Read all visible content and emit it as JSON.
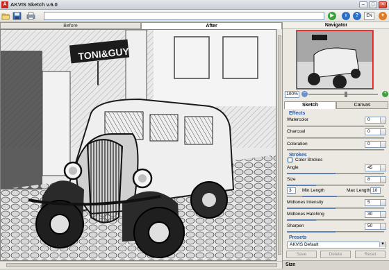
{
  "window": {
    "title": "AKVIS Sketch v.6.0",
    "app_icon": "A"
  },
  "toolbar": {
    "lang": "EN",
    "address": ""
  },
  "view_tabs": {
    "before": "Before",
    "after": "After"
  },
  "navigator": {
    "title": "Navigator",
    "zoom": "100%"
  },
  "panel_tabs": {
    "sketch": "Sketch",
    "canvas": "Canvas"
  },
  "effects": {
    "title": "Effects",
    "items": [
      {
        "label": "Watercolor",
        "value": "0",
        "level": 0
      },
      {
        "label": "Charcoal",
        "value": "0",
        "level": 0
      },
      {
        "label": "Coloration",
        "value": "0",
        "level": 0
      }
    ]
  },
  "strokes": {
    "title": "Strokes",
    "color_strokes": "Color Strokes",
    "angle": {
      "label": "Angle",
      "value": "45",
      "level": 0.5
    },
    "size": {
      "label": "Size",
      "value": "8",
      "level": 0.3
    },
    "min_length": {
      "label": "Min Length",
      "value": "3"
    },
    "max_length": {
      "label": "Max Length",
      "value": "10"
    },
    "midtones_intensity": {
      "label": "Midtones Intensity",
      "value": "5",
      "level": 0.5
    },
    "midtones_hatching": {
      "label": "Midtones Hatching",
      "value": "30",
      "level": 0.3
    },
    "sharpen": {
      "label": "Sharpen",
      "value": "50",
      "level": 0.5
    }
  },
  "presets": {
    "title": "Presets",
    "selected": "AKVIS Default",
    "save": "Save",
    "delete": "Delete",
    "reset": "Reset"
  },
  "size_section": {
    "title": "Size"
  },
  "photo": {
    "sign_text": "TONI&GUY"
  },
  "colors": {
    "accent": "#2a5ba8",
    "close": "#d1402a",
    "go_green": "#3aa23a",
    "info_blue": "#2d6fc7",
    "help_orange": "#e07b21"
  }
}
